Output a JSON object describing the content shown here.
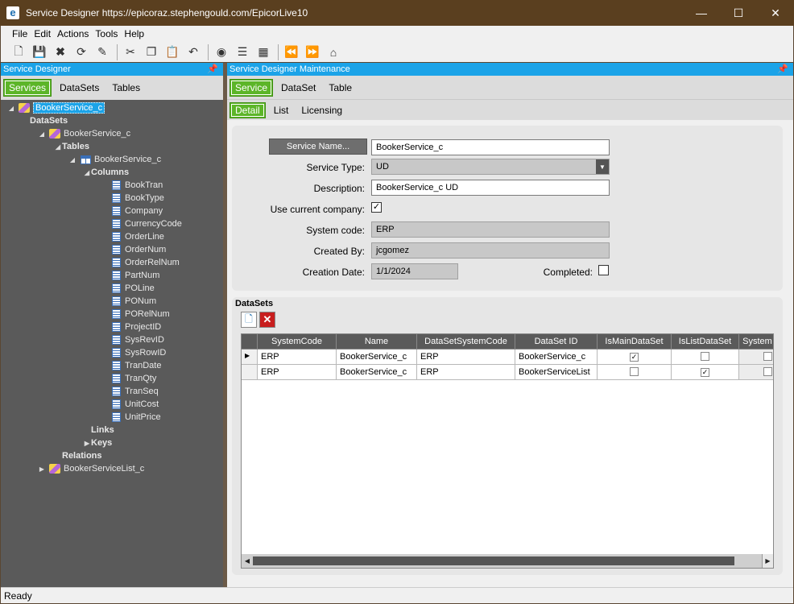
{
  "window": {
    "title": "Service Designer https://epicoraz.stephengould.com/EpicorLive10",
    "app_icon_letter": "e"
  },
  "menu": [
    "File",
    "Edit",
    "Actions",
    "Tools",
    "Help"
  ],
  "toolbar_icons": [
    "new-icon",
    "save-icon",
    "delete-icon",
    "refresh-icon",
    "clear-icon",
    "cut-icon",
    "copy-icon",
    "paste-icon",
    "undo-icon",
    "search-icon",
    "attach-icon",
    "layout-icon",
    "back-icon",
    "forward-icon",
    "home-icon"
  ],
  "left_pane": {
    "title": "Service Designer",
    "tabs": [
      "Services",
      "DataSets",
      "Tables"
    ],
    "active_tab": "Services",
    "tree": {
      "root": "BookerService_c",
      "datasets_label": "DataSets",
      "dataset1": "BookerService_c",
      "tables_label": "Tables",
      "table1": "BookerService_c",
      "columns_label": "Columns",
      "columns": [
        "BookTran",
        "BookType",
        "Company",
        "CurrencyCode",
        "OrderLine",
        "OrderNum",
        "OrderRelNum",
        "PartNum",
        "POLine",
        "PONum",
        "PORelNum",
        "ProjectID",
        "SysRevID",
        "SysRowID",
        "TranDate",
        "TranQty",
        "TranSeq",
        "UnitCost",
        "UnitPrice"
      ],
      "links_label": "Links",
      "keys_label": "Keys",
      "relations_label": "Relations",
      "dataset2": "BookerServiceList_c"
    }
  },
  "right_pane": {
    "title": "Service Designer Maintenance",
    "tabs": [
      "Service",
      "DataSet",
      "Table"
    ],
    "active_tab": "Service",
    "subtabs": [
      "Detail",
      "List",
      "Licensing"
    ],
    "active_subtab": "Detail",
    "form": {
      "service_name_button": "Service Name...",
      "service_name": "BookerService_c",
      "service_type_label": "Service Type:",
      "service_type": "UD",
      "description_label": "Description:",
      "description": "BookerService_c UD",
      "use_current_company_label": "Use current company:",
      "use_current_company": true,
      "system_code_label": "System code:",
      "system_code": "ERP",
      "created_by_label": "Created By:",
      "created_by": "jcgomez",
      "creation_date_label": "Creation Date:",
      "creation_date": "1/1/2024",
      "completed_label": "Completed:",
      "completed": false
    },
    "datasets_section": {
      "title": "DataSets",
      "columns": [
        "SystemCode",
        "Name",
        "DataSetSystemCode",
        "DataSet ID",
        "IsMainDataSet",
        "IsListDataSet",
        "System"
      ],
      "rows": [
        {
          "system_code": "ERP",
          "name": "BookerService_c",
          "dataset_system_code": "ERP",
          "dataset_id": "BookerService_c",
          "is_main": true,
          "is_list": false,
          "system": false,
          "current": true
        },
        {
          "system_code": "ERP",
          "name": "BookerService_c",
          "dataset_system_code": "ERP",
          "dataset_id": "BookerServiceList",
          "is_main": false,
          "is_list": true,
          "system": false,
          "current": false
        }
      ]
    }
  },
  "status": "Ready",
  "colors": {
    "title_bar": "#5a3f1f",
    "pane_header": "#1ba3e8",
    "active_tab": "#5cb528",
    "tree_bg": "#5a5a5a"
  }
}
